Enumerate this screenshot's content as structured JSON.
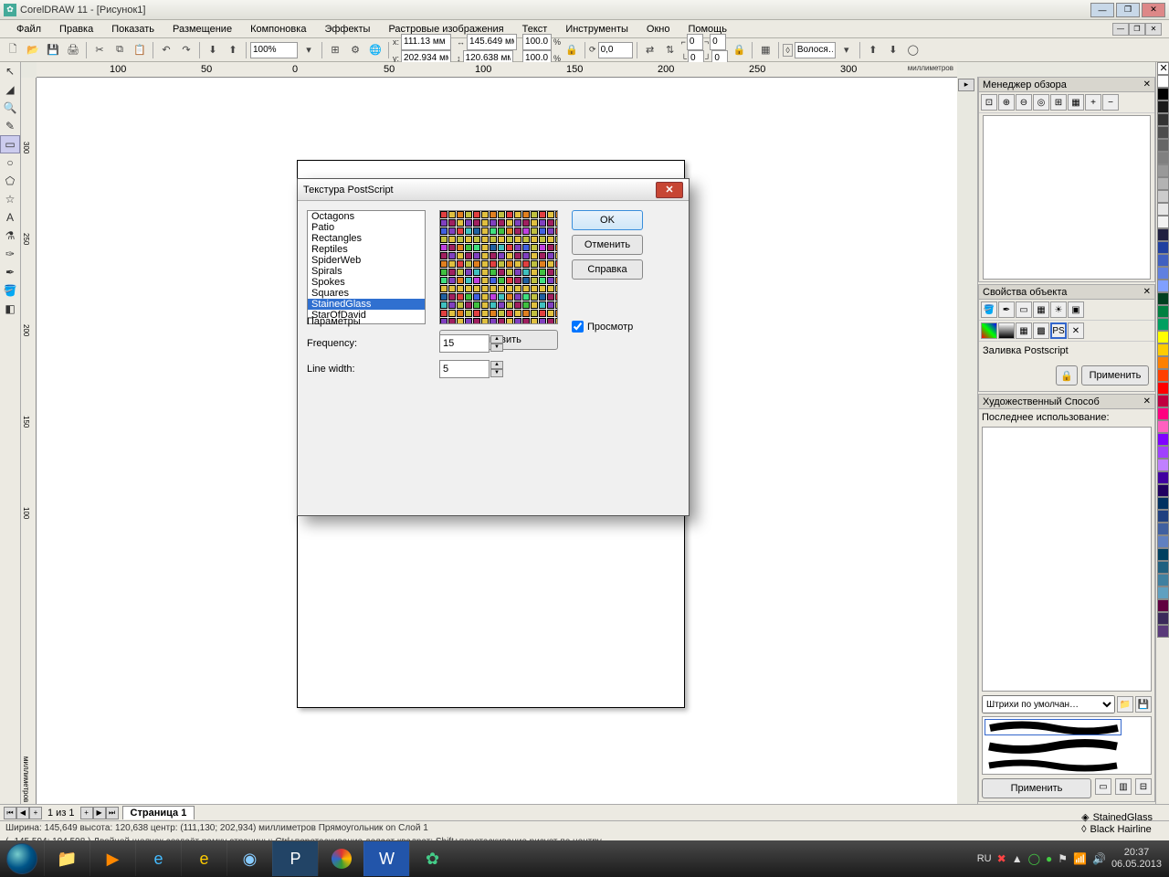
{
  "titlebar": {
    "app": "CorelDRAW 11",
    "doc": "[Рисунок1]"
  },
  "menu": [
    "Файл",
    "Правка",
    "Показать",
    "Размещение",
    "Компоновка",
    "Эффекты",
    "Растровые изображения",
    "Текст",
    "Инструменты",
    "Окно",
    "Помощь"
  ],
  "toolbar2": {
    "zoom": "100%",
    "x": "111.13 мм",
    "y": "202.934 мм",
    "w": "145.649 мм",
    "h": "120.638 мм",
    "sx": "100.0",
    "sy": "100.0",
    "rot": "0,0",
    "gx": "0",
    "gy": "0",
    "hair": "Волося…"
  },
  "ruler_unit_h": "миллиметров",
  "ruler_unit_v": "миллиметров",
  "ruler_marks_h": [
    "100",
    "50",
    "0",
    "50",
    "100",
    "150",
    "200",
    "250",
    "300"
  ],
  "ruler_marks_v": [
    "300",
    "250",
    "200",
    "150",
    "100"
  ],
  "dialog": {
    "title": "Текстура PostScript",
    "textures": [
      "Octagons",
      "Patio",
      "Rectangles",
      "Reptiles",
      "SpiderWeb",
      "Spirals",
      "Spokes",
      "Squares",
      "StainedGlass",
      "StarOfDavid"
    ],
    "selected": "StainedGlass",
    "ok": "OK",
    "cancel": "Отменить",
    "help": "Справка",
    "refresh": "Обновить",
    "preview_check": "Просмотр",
    "params_label": "Параметры",
    "p1_label": "Frequency:",
    "p1_val": "15",
    "p2_label": "Line width:",
    "p2_val": "5"
  },
  "dockers": {
    "d1_title": "Менеджер обзора",
    "d2_title": "Свойства объекта",
    "d2_fill_label": "Заливка Postscript",
    "d2_apply": "Применить",
    "d3_title": "Художественный Способ",
    "d3_last": "Последнее использование:",
    "d3_strokes": "Штрихи по умолчан…",
    "d3_apply": "Применить"
  },
  "pages": {
    "counter": "1 из 1",
    "tab": "Страница 1"
  },
  "status": {
    "line1": "Ширина: 145,649  высота: 120,638  центр: (111,130; 202,934)  миллиметров        Прямоугольник on Слой 1",
    "line2": "( -145,594; 194,598 )       Двойной щелчок создаёт рамку страницы; Ctrl+перетаскивание делает квадрат; Shift+перетаскивание рисует по центру"
  },
  "fill_status": {
    "fill": "StainedGlass",
    "outline": "Black  Hairline"
  },
  "tray": {
    "lang": "RU",
    "time": "20:37",
    "date": "06.05.2013"
  },
  "palette": [
    "#ffffff",
    "#000000",
    "#1a1a1a",
    "#333333",
    "#4d4d4d",
    "#666666",
    "#808080",
    "#999999",
    "#b3b3b3",
    "#cccccc",
    "#e6e6e6",
    "#f2f2f2",
    "#202040",
    "#2040a0",
    "#4060c0",
    "#6080e0",
    "#80a0ff",
    "#004020",
    "#008040",
    "#00a060",
    "#ffff00",
    "#ffcc00",
    "#ff8000",
    "#ff4000",
    "#ff0000",
    "#c00040",
    "#ff0080",
    "#ff60c0",
    "#8000ff",
    "#a040ff",
    "#c080ff",
    "#4000a0",
    "#200060",
    "#003060",
    "#204080",
    "#4060a0",
    "#6080c0",
    "#004060",
    "#206080",
    "#4080a0",
    "#60a0c0",
    "#600040",
    "#3a2a5a",
    "#5a3a7a"
  ]
}
